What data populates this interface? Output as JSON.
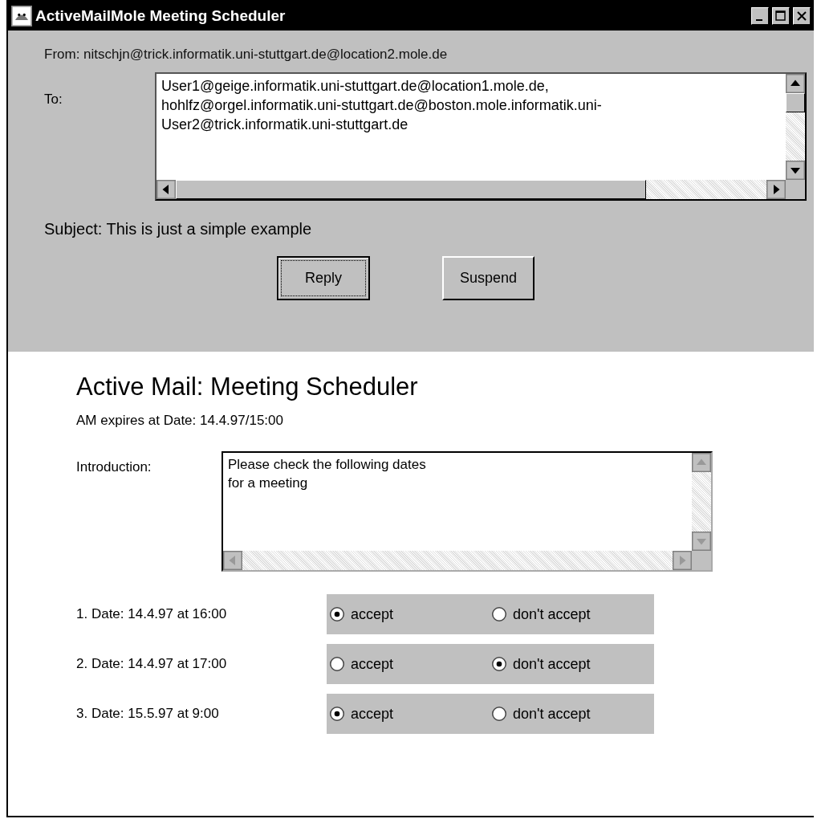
{
  "window": {
    "title": "ActiveMailMole Meeting Scheduler"
  },
  "header": {
    "from": "From: nitschjn@trick.informatik.uni-stuttgart.de@location2.mole.de",
    "to_label": "To:",
    "to_lines": [
      "User1@geige.informatik.uni-stuttgart.de@location1.mole.de,",
      "hohlfz@orgel.informatik.uni-stuttgart.de@boston.mole.informatik.uni-",
      "User2@trick.informatik.uni-stuttgart.de"
    ],
    "subject": "Subject:  This is just a simple example"
  },
  "buttons": [
    {
      "label": "Reply",
      "focused": true
    },
    {
      "label": "Suspend",
      "focused": false
    }
  ],
  "form": {
    "title": "Active Mail: Meeting Scheduler",
    "expires": "AM expires at Date: 14.4.97/15:00",
    "intro_label": "Introduction:",
    "intro_lines": [
      "Please check the following dates",
      "for a meeting"
    ],
    "dates": [
      {
        "label": "1. Date:  14.4.97 at 16:00",
        "options": [
          {
            "label": "accept",
            "selected": true
          },
          {
            "label": "don't accept",
            "selected": false
          }
        ]
      },
      {
        "label": "2. Date: 14.4.97 at 17:00",
        "options": [
          {
            "label": "accept",
            "selected": false
          },
          {
            "label": "don't accept",
            "selected": true
          }
        ]
      },
      {
        "label": "3. Date: 15.5.97 at 9:00",
        "options": [
          {
            "label": "accept",
            "selected": true
          },
          {
            "label": "don't accept",
            "selected": false
          }
        ]
      }
    ]
  }
}
